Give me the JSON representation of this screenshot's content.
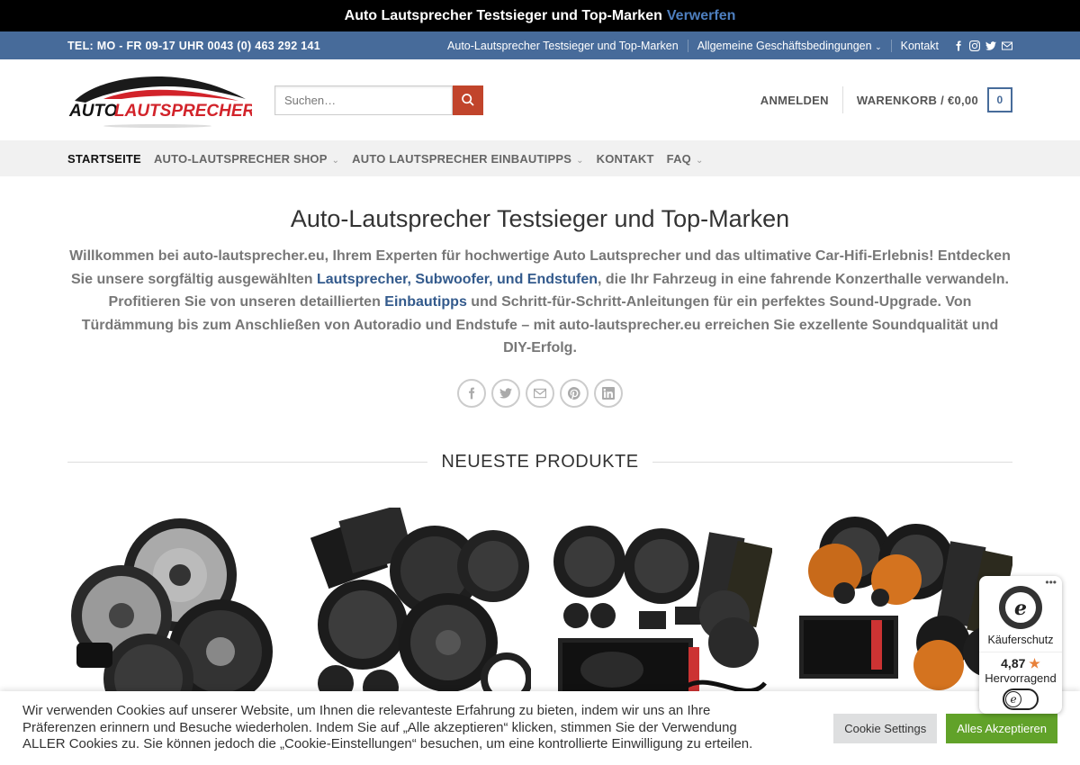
{
  "topbar": {
    "text": "Auto Lautsprecher Testsieger und Top-Marken",
    "dismiss": "Verwerfen"
  },
  "infobar": {
    "tel": "TEL: MO - FR 09-17 UHR 0043 (0) 463 292 141",
    "links": [
      "Auto-Lautsprecher Testsieger und Top-Marken",
      "Allgemeine Geschäftsbedingungen",
      "Kontakt"
    ],
    "social_icons": [
      "facebook-icon",
      "instagram-icon",
      "twitter-icon",
      "mail-icon"
    ]
  },
  "header": {
    "logo_text": "AUTO LAUTSPRECHER",
    "logo_part1": "AUTO",
    "logo_part2": "LAUTSPRECHER",
    "search_placeholder": "Suchen…",
    "login": "ANMELDEN",
    "cart": "WARENKORB / €0,00",
    "cart_count": "0"
  },
  "nav": {
    "items": [
      {
        "label": "STARTSEITE"
      },
      {
        "label": "AUTO-LAUTSPRECHER SHOP"
      },
      {
        "label": "AUTO LAUTSPRECHER EINBAUTIPPS"
      },
      {
        "label": "KONTAKT"
      },
      {
        "label": "FAQ"
      }
    ]
  },
  "main": {
    "title": "Auto-Lautsprecher Testsieger und Top-Marken",
    "intro_part1": "Willkommen bei auto-lautsprecher.eu, Ihrem Experten für hochwertige Auto Lautsprecher und das ultimative Car-Hifi-Erlebnis! Entdecken Sie unsere sorgfältig ausgewählten ",
    "intro_link1": "Lautsprecher, Subwoofer, und Endstufen",
    "intro_part2": ", die Ihr Fahrzeug in eine fahrende Konzerthalle verwandeln. Profitieren Sie von unseren detaillierten ",
    "intro_link2": "Einbautipps",
    "intro_part3": " und Schritt-für-Schritt-Anleitungen für ein perfektes Sound-Upgrade. Von Türdämmung bis zum Anschließen von Autoradio und Endstufe – mit auto-lautsprecher.eu erreichen Sie exzellente Soundqualität und DIY-Erfolg.",
    "share_icons": [
      "facebook-icon",
      "twitter-icon",
      "mail-icon",
      "pinterest-icon",
      "linkedin-icon"
    ],
    "section_title": "NEUESTE PRODUKTE"
  },
  "cookie": {
    "text": "Wir verwenden Cookies auf unserer Website, um Ihnen die relevanteste Erfahrung zu bieten, indem wir uns an Ihre Präferenzen erinnern und Besuche wiederholen. Indem Sie auf „Alle akzeptieren“ klicken, stimmen Sie der Verwendung ALLER Cookies zu. Sie können jedoch die „Cookie-Einstellungen“ besuchen, um eine kontrollierte Einwilligung zu erteilen.",
    "settings": "Cookie Settings",
    "accept": "Alles Akzeptieren"
  },
  "trusted_shops": {
    "label": "Käuferschutz",
    "rating": "4,87",
    "grade": "Hervorragend",
    "dots": "•••"
  },
  "colors": {
    "brand_blue": "#476b9a",
    "accent_red": "#c1442b",
    "accept_green": "#61a229"
  }
}
